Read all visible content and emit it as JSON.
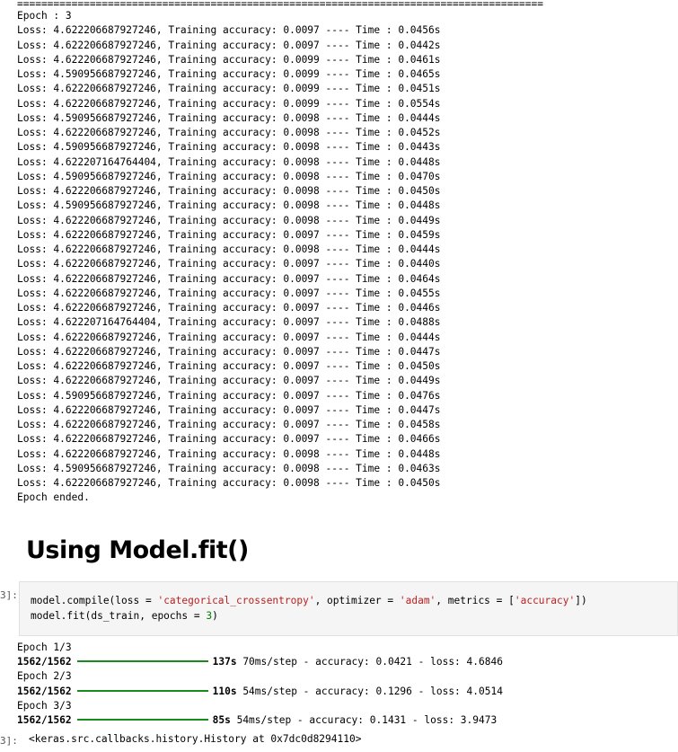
{
  "separator": "=======================================================================================",
  "epoch_header": "Epoch : 3",
  "train_log": [
    {
      "loss": "4.622206687927246",
      "acc": "0.0097",
      "time": "0.0456s"
    },
    {
      "loss": "4.622206687927246",
      "acc": "0.0097",
      "time": "0.0442s"
    },
    {
      "loss": "4.622206687927246",
      "acc": "0.0099",
      "time": "0.0461s"
    },
    {
      "loss": "4.590956687927246",
      "acc": "0.0099",
      "time": "0.0465s"
    },
    {
      "loss": "4.622206687927246",
      "acc": "0.0099",
      "time": "0.0451s"
    },
    {
      "loss": "4.622206687927246",
      "acc": "0.0099",
      "time": "0.0554s"
    },
    {
      "loss": "4.590956687927246",
      "acc": "0.0098",
      "time": "0.0444s"
    },
    {
      "loss": "4.622206687927246",
      "acc": "0.0098",
      "time": "0.0452s"
    },
    {
      "loss": "4.590956687927246",
      "acc": "0.0098",
      "time": "0.0443s"
    },
    {
      "loss": "4.622207164764404",
      "acc": "0.0098",
      "time": "0.0448s"
    },
    {
      "loss": "4.590956687927246",
      "acc": "0.0098",
      "time": "0.0470s"
    },
    {
      "loss": "4.622206687927246",
      "acc": "0.0098",
      "time": "0.0450s"
    },
    {
      "loss": "4.590956687927246",
      "acc": "0.0098",
      "time": "0.0448s"
    },
    {
      "loss": "4.622206687927246",
      "acc": "0.0098",
      "time": "0.0449s"
    },
    {
      "loss": "4.622206687927246",
      "acc": "0.0097",
      "time": "0.0459s"
    },
    {
      "loss": "4.622206687927246",
      "acc": "0.0098",
      "time": "0.0444s"
    },
    {
      "loss": "4.622206687927246",
      "acc": "0.0097",
      "time": "0.0440s"
    },
    {
      "loss": "4.622206687927246",
      "acc": "0.0097",
      "time": "0.0464s"
    },
    {
      "loss": "4.622206687927246",
      "acc": "0.0097",
      "time": "0.0455s"
    },
    {
      "loss": "4.622206687927246",
      "acc": "0.0097",
      "time": "0.0446s"
    },
    {
      "loss": "4.622207164764404",
      "acc": "0.0097",
      "time": "0.0488s"
    },
    {
      "loss": "4.622206687927246",
      "acc": "0.0097",
      "time": "0.0444s"
    },
    {
      "loss": "4.622206687927246",
      "acc": "0.0097",
      "time": "0.0447s"
    },
    {
      "loss": "4.622206687927246",
      "acc": "0.0097",
      "time": "0.0450s"
    },
    {
      "loss": "4.622206687927246",
      "acc": "0.0097",
      "time": "0.0449s"
    },
    {
      "loss": "4.590956687927246",
      "acc": "0.0097",
      "time": "0.0476s"
    },
    {
      "loss": "4.622206687927246",
      "acc": "0.0097",
      "time": "0.0447s"
    },
    {
      "loss": "4.622206687927246",
      "acc": "0.0097",
      "time": "0.0458s"
    },
    {
      "loss": "4.622206687927246",
      "acc": "0.0097",
      "time": "0.0466s"
    },
    {
      "loss": "4.622206687927246",
      "acc": "0.0098",
      "time": "0.0448s"
    },
    {
      "loss": "4.590956687927246",
      "acc": "0.0098",
      "time": "0.0463s"
    },
    {
      "loss": "4.622206687927246",
      "acc": "0.0098",
      "time": "0.0450s"
    }
  ],
  "log_labels": {
    "loss": "Loss: ",
    "acc": ", Training accuracy: ",
    "time": " ---- Time : "
  },
  "epoch_ended": "Epoch ended.",
  "heading": "Using Model.fit()",
  "code_prompt": "3]:",
  "code_lines": [
    [
      {
        "t": "model.compile(loss = ",
        "c": ""
      },
      {
        "t": "'categorical_crossentropy'",
        "c": "str"
      },
      {
        "t": ", optimizer = ",
        "c": ""
      },
      {
        "t": "'adam'",
        "c": "str"
      },
      {
        "t": ", metrics = [",
        "c": ""
      },
      {
        "t": "'accuracy'",
        "c": "str"
      },
      {
        "t": "])",
        "c": ""
      }
    ],
    [
      {
        "t": "model.fit(ds_train, epochs = ",
        "c": ""
      },
      {
        "t": "3",
        "c": "num"
      },
      {
        "t": ")",
        "c": ""
      }
    ]
  ],
  "fit_epochs": [
    {
      "header": "Epoch 1/3",
      "steps": "1562/1562",
      "elapsed": "137s",
      "rest": " 70ms/step - accuracy: 0.0421 - loss: 4.6846",
      "progress": 1.0
    },
    {
      "header": "Epoch 2/3",
      "steps": "1562/1562",
      "elapsed": "110s",
      "rest": " 54ms/step - accuracy: 0.1296 - loss: 4.0514",
      "progress": 1.0
    },
    {
      "header": "Epoch 3/3",
      "steps": "1562/1562",
      "elapsed": "85s",
      "rest": " 54ms/step - accuracy: 0.1431 - loss: 3.9473",
      "progress": 1.0
    }
  ],
  "result_prompt": "3]:",
  "result_text": "<keras.src.callbacks.history.History at 0x7dc0d8294110>",
  "colors": {
    "progress_bar": "#198a1c",
    "string_token": "#ba2121",
    "number_token": "#008000",
    "code_bg": "#f5f5f5"
  }
}
